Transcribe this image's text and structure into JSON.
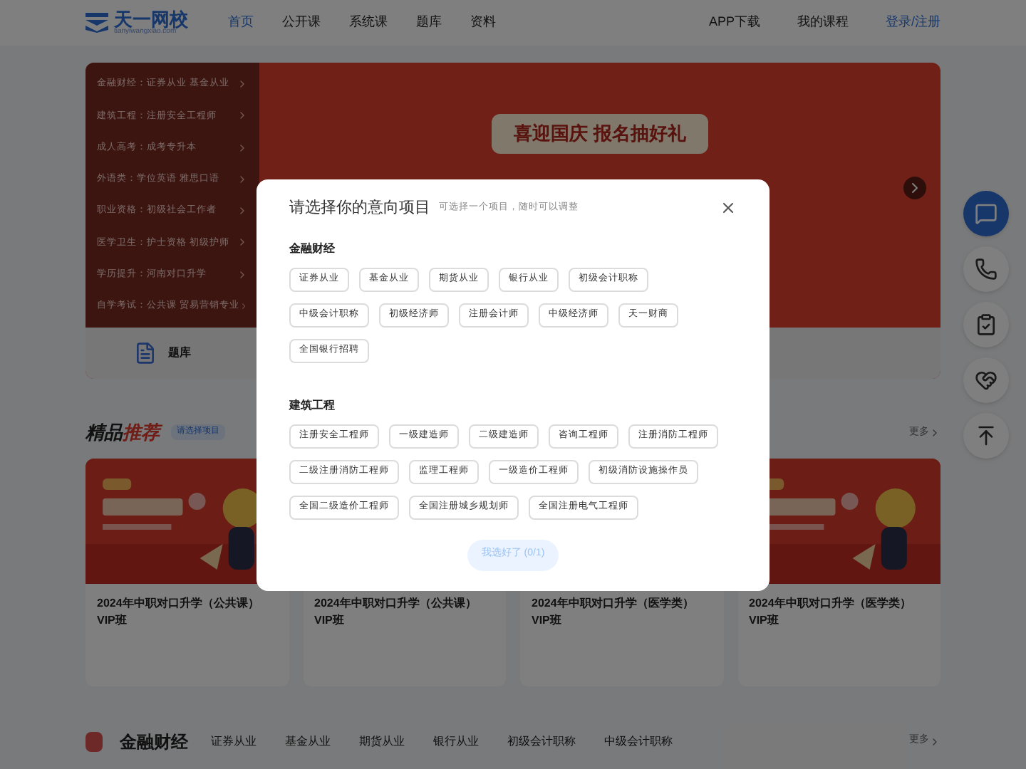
{
  "header": {
    "logo": "天一网校",
    "logo_sub": "tianyiwangxiao.com",
    "nav": [
      {
        "label": "首页",
        "selected": true
      },
      {
        "label": "公开课",
        "selected": false
      },
      {
        "label": "系统课",
        "selected": false
      },
      {
        "label": "题库",
        "selected": false
      },
      {
        "label": "资料",
        "selected": false
      }
    ],
    "links": [
      "APP下载",
      "我的课程"
    ],
    "login": "登录/注册"
  },
  "category_menu": [
    {
      "label": "金融财经：证券从业 基金从业"
    },
    {
      "label": "建筑工程：注册安全工程师"
    },
    {
      "label": "成人高考：成考专升本"
    },
    {
      "label": "外语类：学位英语 雅思口语"
    },
    {
      "label": "职业资格：初级社会工作者"
    },
    {
      "label": "医学卫生：护士资格 初级护师"
    },
    {
      "label": "学历提升：河南对口升学"
    },
    {
      "label": "自学考试：公共课 贸易营销专业"
    }
  ],
  "banner": {
    "headline": "喜迎国庆 报名抽好礼"
  },
  "quick_bar": {
    "label": "题库"
  },
  "featured": {
    "title_plain": "精品",
    "title_accent": "推荐",
    "tag": "请选择项目",
    "more": "更多",
    "cards": [
      {
        "kind": "picture",
        "title": "2024年中职对口升学（公共课）VIP班"
      },
      {
        "title": "2024年中职对口升学（公共课）VIP班"
      },
      {
        "title": "2024年中职对口升学（医学类）VIP班"
      },
      {
        "kind": "picture",
        "title": "2024年中职对口升学（医学类）VIP班"
      }
    ]
  },
  "finance_section": {
    "title": "金融财经",
    "tabs": [
      "证券从业",
      "基金从业",
      "期货从业",
      "银行从业",
      "初级会计职称",
      "中级会计职称"
    ],
    "more": "更多"
  },
  "side_buttons": [
    {
      "kind": "chat"
    },
    {
      "kind": "phone"
    },
    {
      "kind": "clipboard"
    },
    {
      "kind": "heart"
    },
    {
      "kind": "top"
    }
  ],
  "modal": {
    "title": "请选择你的意向项目",
    "hint": "可选择一个项目，随时可以调整",
    "groups": [
      {
        "name": "金融财经",
        "options": [
          {
            "label": "证券从业",
            "selected": false
          },
          {
            "label": "基金从业",
            "selected": false
          },
          {
            "label": "期货从业",
            "selected": false
          },
          {
            "label": "银行从业",
            "selected": false
          },
          {
            "label": "初级会计职称",
            "selected": false
          },
          {
            "label": "中级会计职称",
            "selected": false
          },
          {
            "label": "初级经济师",
            "selected": false
          },
          {
            "label": "注册会计师",
            "selected": false
          },
          {
            "label": "中级经济师",
            "selected": false
          },
          {
            "label": "天一财商",
            "selected": false
          },
          {
            "label": "全国银行招聘",
            "selected": false
          }
        ]
      },
      {
        "name": "建筑工程",
        "options": [
          {
            "label": "注册安全工程师",
            "selected": false
          },
          {
            "label": "一级建造师",
            "selected": false
          },
          {
            "label": "二级建造师",
            "selected": false
          },
          {
            "label": "咨询工程师",
            "selected": false
          },
          {
            "label": "注册消防工程师",
            "selected": false
          },
          {
            "label": "二级注册消防工程师",
            "selected": false
          },
          {
            "label": "监理工程师",
            "selected": false
          },
          {
            "label": "一级造价工程师",
            "selected": false
          },
          {
            "label": "初级消防设施操作员",
            "selected": false
          },
          {
            "label": "全国二级造价工程师",
            "selected": false
          },
          {
            "label": "全国注册城乡规划师",
            "selected": false
          },
          {
            "label": "全国注册电气工程师",
            "selected": false
          }
        ]
      }
    ],
    "confirm": "我选好了 (0/1)"
  }
}
